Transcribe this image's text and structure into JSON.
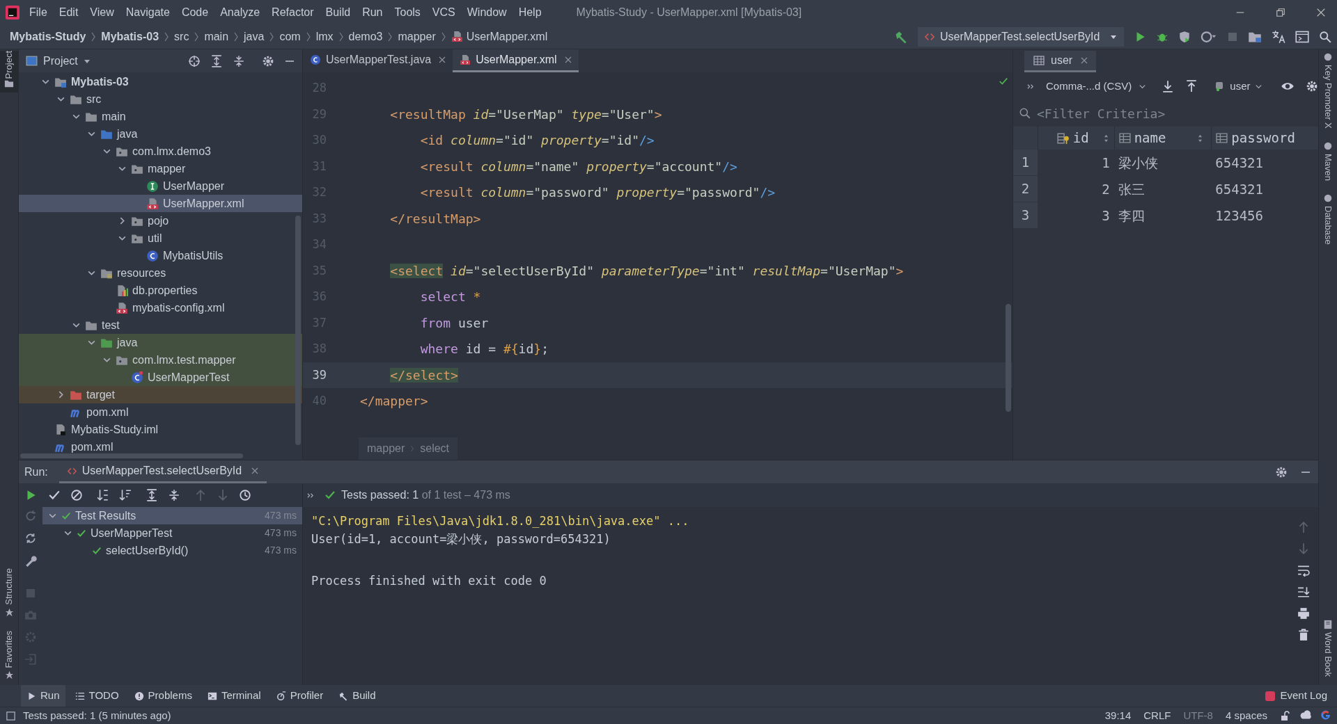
{
  "menu": [
    "File",
    "Edit",
    "View",
    "Navigate",
    "Code",
    "Analyze",
    "Refactor",
    "Build",
    "Run",
    "Tools",
    "VCS",
    "Window",
    "Help"
  ],
  "window": {
    "title": "Mybatis-Study - UserMapper.xml [Mybatis-03]"
  },
  "breadcrumbs": [
    {
      "label": "Mybatis-Study",
      "bold": true
    },
    {
      "label": "Mybatis-03",
      "bold": true
    },
    {
      "label": "src",
      "bold": false
    },
    {
      "label": "main",
      "bold": false
    },
    {
      "label": "java",
      "bold": false
    },
    {
      "label": "com",
      "bold": false
    },
    {
      "label": "lmx",
      "bold": false
    },
    {
      "label": "demo3",
      "bold": false
    },
    {
      "label": "mapper",
      "bold": false
    },
    {
      "label": "UserMapper.xml",
      "bold": false,
      "kind": "xml"
    }
  ],
  "run_config": {
    "label": "UserMapperTest.selectUserById"
  },
  "left_stripe": {
    "top": [
      "Project"
    ],
    "bottom": [
      "Structure",
      "Favorites"
    ]
  },
  "right_stripe": [
    "Key Promoter X",
    "Maven",
    "Database"
  ],
  "right_stripe_bottom": [
    "Word Book"
  ],
  "project_panel": {
    "title": "Project",
    "tree": [
      {
        "label": "Mybatis-03",
        "kind": "module",
        "bold": true,
        "expanded": true,
        "selected": false,
        "children": [
          {
            "label": "src",
            "kind": "folder",
            "expanded": true,
            "selected": false,
            "children": [
              {
                "label": "main",
                "kind": "folder",
                "expanded": true,
                "selected": false,
                "children": [
                  {
                    "label": "java",
                    "kind": "source-folder",
                    "expanded": true,
                    "selected": false,
                    "children": [
                      {
                        "label": "com.lmx.demo3",
                        "kind": "package",
                        "expanded": true,
                        "selected": false,
                        "children": [
                          {
                            "label": "mapper",
                            "kind": "package",
                            "expanded": true,
                            "selected": false,
                            "children": [
                              {
                                "label": "UserMapper",
                                "kind": "interface",
                                "selected": false
                              },
                              {
                                "label": "UserMapper.xml",
                                "kind": "xml",
                                "selected": true
                              }
                            ]
                          },
                          {
                            "label": "pojo",
                            "kind": "package",
                            "expanded": false,
                            "selected": false
                          },
                          {
                            "label": "util",
                            "kind": "package",
                            "expanded": true,
                            "selected": false,
                            "children": [
                              {
                                "label": "MybatisUtils",
                                "kind": "class",
                                "selected": false
                              }
                            ]
                          }
                        ]
                      }
                    ]
                  },
                  {
                    "label": "resources",
                    "kind": "resources",
                    "expanded": true,
                    "selected": false,
                    "children": [
                      {
                        "label": "db.properties",
                        "kind": "properties",
                        "selected": false
                      },
                      {
                        "label": "mybatis-config.xml",
                        "kind": "xml",
                        "selected": false
                      }
                    ]
                  }
                ]
              },
              {
                "label": "test",
                "kind": "folder",
                "expanded": true,
                "selected": false,
                "children": [
                  {
                    "label": "java",
                    "kind": "test-folder",
                    "expanded": true,
                    "selected": false,
                    "test_scope": true,
                    "children": [
                      {
                        "label": "com.lmx.test.mapper",
                        "kind": "package",
                        "expanded": true,
                        "selected": false,
                        "test_scope": true,
                        "children": [
                          {
                            "label": "UserMapperTest",
                            "kind": "test-class",
                            "selected": false,
                            "test_scope": true
                          }
                        ]
                      }
                    ]
                  }
                ]
              }
            ]
          },
          {
            "label": "target",
            "kind": "excluded",
            "expanded": false,
            "selected": false,
            "excluded": true
          },
          {
            "label": "pom.xml",
            "kind": "maven",
            "selected": false
          }
        ]
      },
      {
        "label": "Mybatis-Study.iml",
        "kind": "iml",
        "selected": false
      },
      {
        "label": "pom.xml",
        "kind": "maven",
        "selected": false
      }
    ]
  },
  "editor": {
    "tabs": [
      {
        "label": "UserMapperTest.java",
        "kind": "class",
        "selected": false
      },
      {
        "label": "UserMapper.xml",
        "kind": "xml",
        "selected": true
      }
    ],
    "lines": [
      {
        "number": "28",
        "current": false
      },
      {
        "number": "29",
        "current": false,
        "tokens": [
          {
            "text": "    <resultMap ",
            "kind": "tag"
          },
          {
            "text": "id",
            "kind": "attr"
          },
          {
            "text": "=\"UserMap\" ",
            "kind": "value"
          },
          {
            "text": "type",
            "kind": "attr"
          },
          {
            "text": "=\"User\"",
            "kind": "value"
          },
          {
            "text": ">",
            "kind": "tag"
          }
        ]
      },
      {
        "number": "30",
        "current": false,
        "tokens": [
          {
            "text": "        <id ",
            "kind": "tag"
          },
          {
            "text": "column",
            "kind": "attr"
          },
          {
            "text": "=\"id\" ",
            "kind": "value"
          },
          {
            "text": "property",
            "kind": "attr"
          },
          {
            "text": "=\"id\"",
            "kind": "value"
          },
          {
            "text": "/>",
            "kind": "close"
          }
        ]
      },
      {
        "number": "31",
        "current": false,
        "tokens": [
          {
            "text": "        <result ",
            "kind": "tag"
          },
          {
            "text": "column",
            "kind": "attr"
          },
          {
            "text": "=\"name\" ",
            "kind": "value"
          },
          {
            "text": "property",
            "kind": "attr"
          },
          {
            "text": "=\"account\"",
            "kind": "value"
          },
          {
            "text": "/>",
            "kind": "close"
          }
        ]
      },
      {
        "number": "32",
        "current": false,
        "tokens": [
          {
            "text": "        <result ",
            "kind": "tag"
          },
          {
            "text": "column",
            "kind": "attr"
          },
          {
            "text": "=\"password\" ",
            "kind": "value"
          },
          {
            "text": "property",
            "kind": "attr"
          },
          {
            "text": "=\"password\"",
            "kind": "value"
          },
          {
            "text": "/>",
            "kind": "close"
          }
        ]
      },
      {
        "number": "33",
        "current": false,
        "tokens": [
          {
            "text": "    </resultMap>",
            "kind": "tag"
          }
        ]
      },
      {
        "number": "34",
        "current": false
      },
      {
        "number": "35",
        "current": false,
        "tokens": [
          {
            "text": "    <select",
            "kind": "tag-match"
          },
          {
            "text": " id",
            "kind": "attr"
          },
          {
            "text": "=\"selectUserById\" ",
            "kind": "value"
          },
          {
            "text": "parameterType",
            "kind": "attr"
          },
          {
            "text": "=\"int\" ",
            "kind": "value"
          },
          {
            "text": "resultMap",
            "kind": "attr"
          },
          {
            "text": "=\"UserMap\"",
            "kind": "value"
          },
          {
            "text": ">",
            "kind": "tag"
          }
        ]
      },
      {
        "number": "36",
        "current": false,
        "tokens": [
          {
            "text": "        select ",
            "kind": "sql"
          },
          {
            "text": "*",
            "kind": "param"
          }
        ]
      },
      {
        "number": "37",
        "current": false,
        "tokens": [
          {
            "text": "        from ",
            "kind": "sql"
          },
          {
            "text": "user",
            "kind": "plain"
          }
        ]
      },
      {
        "number": "38",
        "current": false,
        "tokens": [
          {
            "text": "        where ",
            "kind": "sql"
          },
          {
            "text": "id = ",
            "kind": "plain"
          },
          {
            "text": "#{",
            "kind": "param"
          },
          {
            "text": "id",
            "kind": "plain"
          },
          {
            "text": "}",
            "kind": "param"
          },
          {
            "text": ";",
            "kind": "plain"
          }
        ]
      },
      {
        "number": "39",
        "current": true,
        "tokens": [
          {
            "text": "    </select>",
            "kind": "tag-match"
          }
        ]
      },
      {
        "number": "40",
        "current": false,
        "tokens": [
          {
            "text": "</mapper>",
            "kind": "tag"
          }
        ]
      }
    ],
    "breadcrumbs": [
      "mapper",
      "select"
    ]
  },
  "database": {
    "tab": "user",
    "export_format": "Comma-...d (CSV)",
    "table_selector": "user",
    "filter_placeholder": "<Filter Criteria>",
    "columns": [
      {
        "label": "id",
        "kind": "key"
      },
      {
        "label": "name",
        "kind": "plain"
      },
      {
        "label": "password",
        "kind": "plain"
      }
    ],
    "rows": [
      {
        "number": "1",
        "cells": [
          "1",
          "梁小侠",
          "654321"
        ]
      },
      {
        "number": "2",
        "cells": [
          "2",
          "张三",
          "654321"
        ]
      },
      {
        "number": "3",
        "cells": [
          "3",
          "李四",
          "123456"
        ]
      }
    ]
  },
  "run": {
    "label": "Run:",
    "tab": "UserMapperTest.selectUserById",
    "summary": {
      "status": "Tests passed: ",
      "count": "1",
      "detail": " of 1 test – 473 ms"
    },
    "results": [
      {
        "label": "Test Results",
        "time": "473 ms",
        "selected": true,
        "expanded": true,
        "children": [
          {
            "label": "UserMapperTest",
            "time": "473 ms",
            "selected": false,
            "expanded": true,
            "children": [
              {
                "label": "selectUserById()",
                "time": "473 ms",
                "selected": false
              }
            ]
          }
        ]
      }
    ],
    "console": [
      {
        "text": "\"C:\\Program Files\\Java\\jdk1.8.0_281\\bin\\java.exe\" ...",
        "kind": "command"
      },
      {
        "text": "User(id=1, account=梁小侠, password=654321)",
        "kind": "output"
      },
      {
        "text": "Process finished with exit code 0",
        "kind": "exit"
      }
    ]
  },
  "bottom_tabs": [
    {
      "label": "Run",
      "kind": "play",
      "selected": true
    },
    {
      "label": "TODO",
      "kind": "list",
      "selected": false
    },
    {
      "label": "Problems",
      "kind": "info",
      "selected": false
    },
    {
      "label": "Terminal",
      "kind": "terminal",
      "selected": false
    },
    {
      "label": "Profiler",
      "kind": "profiler",
      "selected": false
    },
    {
      "label": "Build",
      "kind": "hammer",
      "selected": false
    }
  ],
  "event_log": "Event Log",
  "status_bar": {
    "message": "Tests passed: 1 (5 minutes ago)",
    "items": [
      {
        "text": "39:14",
        "disabled": false
      },
      {
        "text": "CRLF",
        "disabled": false
      },
      {
        "text": "UTF-8",
        "disabled": true
      },
      {
        "text": "4 spaces",
        "disabled": false
      }
    ]
  }
}
